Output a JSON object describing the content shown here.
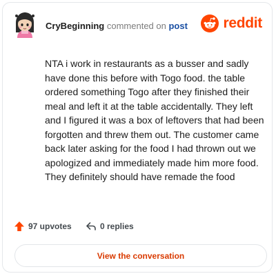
{
  "header": {
    "author": "CryBeginning",
    "action_text": "commented on",
    "target": "post",
    "brand": "reddit"
  },
  "comment": {
    "body": "NTA i work in restaurants as a busser and sadly have done this before with Togo food. the table ordered something Togo after they finished their meal and left it at the table accidentally. They left and I figured it was a box of leftovers that had been forgotten and threw them out. The customer came back later asking for the food I had thrown out we apologized and immediately made him more food. They definitely should have remade the food"
  },
  "actions": {
    "upvotes_label": "97 upvotes",
    "replies_label": "0 replies",
    "upvote_icon": "arrow-up-icon",
    "reply_icon": "reply-arrow-icon"
  },
  "cta": {
    "label": "View the conversation"
  },
  "colors": {
    "brand": "#ff4500",
    "cta_text": "#d93a00",
    "link": "#1a4fa3",
    "upvote": "#ff4500"
  }
}
